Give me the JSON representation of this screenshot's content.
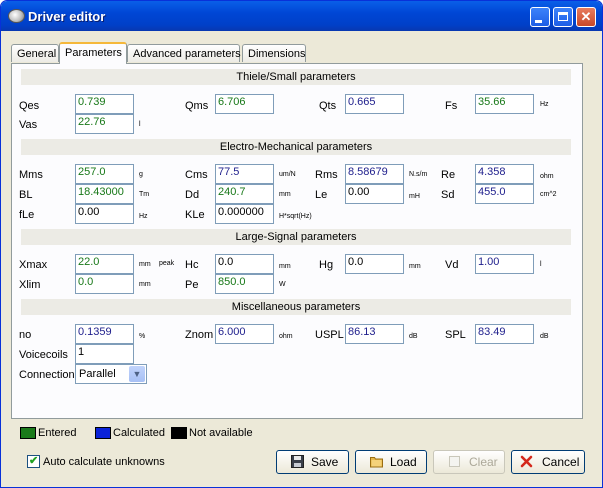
{
  "window": {
    "title": "Driver editor"
  },
  "tabs": [
    "General",
    "Parameters",
    "Advanced parameters",
    "Dimensions"
  ],
  "sections": {
    "thiele": "Thiele/Small parameters",
    "electro": "Electro-Mechanical parameters",
    "large": "Large-Signal parameters",
    "misc": "Miscellaneous parameters"
  },
  "params": {
    "qes": {
      "label": "Qes",
      "value": "0.739"
    },
    "qms": {
      "label": "Qms",
      "value": "6.706"
    },
    "qts": {
      "label": "Qts",
      "value": "0.665"
    },
    "fs": {
      "label": "Fs",
      "value": "35.66",
      "unit": "Hz"
    },
    "vas": {
      "label": "Vas",
      "value": "22.76",
      "unit": "l"
    },
    "mms": {
      "label": "Mms",
      "value": "257.0",
      "unit": "g"
    },
    "cms": {
      "label": "Cms",
      "value": "77.5",
      "unit": "um/N"
    },
    "rms": {
      "label": "Rms",
      "value": "8.58679",
      "unit": "N.s/m"
    },
    "re": {
      "label": "Re",
      "value": "4.358",
      "unit": "ohm"
    },
    "bl": {
      "label": "BL",
      "value": "18.43000",
      "unit": "Tm"
    },
    "dd": {
      "label": "Dd",
      "value": "240.7",
      "unit": "mm"
    },
    "le": {
      "label": "Le",
      "value": "0.00",
      "unit": "mH"
    },
    "sd": {
      "label": "Sd",
      "value": "455.0",
      "unit": "cm^2"
    },
    "fle": {
      "label": "fLe",
      "value": "0.00",
      "unit": "Hz"
    },
    "kle": {
      "label": "KLe",
      "value": "0.000000",
      "unit": "H*sqrt(Hz)"
    },
    "xmax": {
      "label": "Xmax",
      "value": "22.0",
      "unit": "mm",
      "unit2": "peak"
    },
    "hc": {
      "label": "Hc",
      "value": "0.0",
      "unit": "mm"
    },
    "hg": {
      "label": "Hg",
      "value": "0.0",
      "unit": "mm"
    },
    "vd": {
      "label": "Vd",
      "value": "1.00",
      "unit": "l"
    },
    "xlim": {
      "label": "Xlim",
      "value": "0.0",
      "unit": "mm"
    },
    "pe": {
      "label": "Pe",
      "value": "850.0",
      "unit": "W"
    },
    "no": {
      "label": "no",
      "value": "0.1359",
      "unit": "%"
    },
    "znom": {
      "label": "Znom",
      "value": "6.000",
      "unit": "ohm"
    },
    "uspl": {
      "label": "USPL",
      "value": "86.13",
      "unit": "dB"
    },
    "spl": {
      "label": "SPL",
      "value": "83.49",
      "unit": "dB"
    },
    "voicecoils": {
      "label": "Voicecoils",
      "value": "1"
    },
    "connection": {
      "label": "Connection",
      "value": "Parallel"
    }
  },
  "legend": {
    "entered": "Entered",
    "calculated": "Calculated",
    "not_available": "Not available"
  },
  "colors": {
    "entered": "#1a7a1a",
    "calculated": "#0a22d8",
    "not_available": "#000000"
  },
  "auto_calc": {
    "label": "Auto calculate unknowns",
    "checked": true
  },
  "buttons": {
    "save": "Save",
    "load": "Load",
    "clear": "Clear",
    "cancel": "Cancel"
  }
}
